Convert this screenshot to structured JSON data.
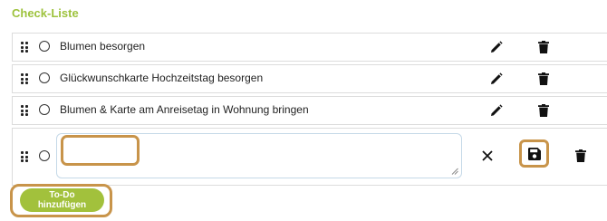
{
  "header": {
    "title": "Check-Liste"
  },
  "items": [
    {
      "label": "Blumen besorgen"
    },
    {
      "label": "Glückwunschkarte Hochzeitstag besorgen"
    },
    {
      "label": "Blumen & Karte am Anreisetag in Wohnung bringen"
    }
  ],
  "new_item": {
    "value": "",
    "placeholder": ""
  },
  "footer": {
    "add_button_label": "To-Do hinzufügen"
  },
  "colors": {
    "accent": "#9dc23c",
    "button": "#a2c13c",
    "highlight": "#c8944a"
  },
  "icons": {
    "drag": "drag-handle-icon",
    "check": "radio-circle-icon",
    "edit": "pencil-icon",
    "delete": "trash-icon",
    "cancel": "close-icon",
    "save": "floppy-disk-icon"
  }
}
